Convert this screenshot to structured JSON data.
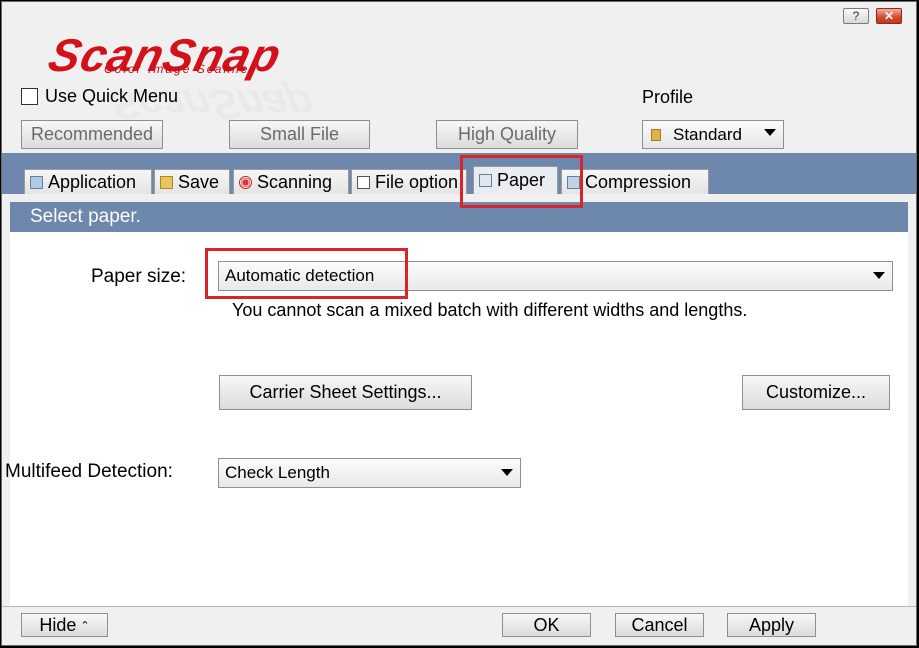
{
  "titlebar": {
    "help_label": "?",
    "close_label": "✕"
  },
  "logo": {
    "brand": "ScanSnap",
    "tagline": "Color Image Scanner"
  },
  "quick_menu": {
    "label": "Use Quick Menu",
    "checked": false
  },
  "profile": {
    "label": "Profile",
    "selected": "Standard",
    "icon": "folder-icon"
  },
  "presets": {
    "recommended": "Recommended",
    "small_file": "Small File",
    "high_quality": "High Quality"
  },
  "tabs": [
    {
      "label": "Application",
      "icon": "application-icon"
    },
    {
      "label": "Save",
      "icon": "save-folder-icon"
    },
    {
      "label": "Scanning",
      "icon": "scanning-icon"
    },
    {
      "label": "File option",
      "icon": "file-icon"
    },
    {
      "label": "Paper",
      "icon": "paper-icon",
      "active": true
    },
    {
      "label": "Compression",
      "icon": "compression-icon"
    }
  ],
  "section": {
    "title": "Select paper."
  },
  "paper": {
    "size_label": "Paper size:",
    "size_value": "Automatic detection",
    "note": "You cannot scan a mixed batch with different widths and lengths.",
    "carrier_button": "Carrier Sheet Settings...",
    "customize_button": "Customize..."
  },
  "multifeed": {
    "label": "Multifeed Detection:",
    "value": "Check Length"
  },
  "footer": {
    "hide": "Hide",
    "hide_chevron": "⌃",
    "ok": "OK",
    "cancel": "Cancel",
    "apply": "Apply"
  },
  "colors": {
    "accent_bar": "#6d87ad",
    "logo_red": "#d4101a",
    "highlight": "#d9242b"
  }
}
